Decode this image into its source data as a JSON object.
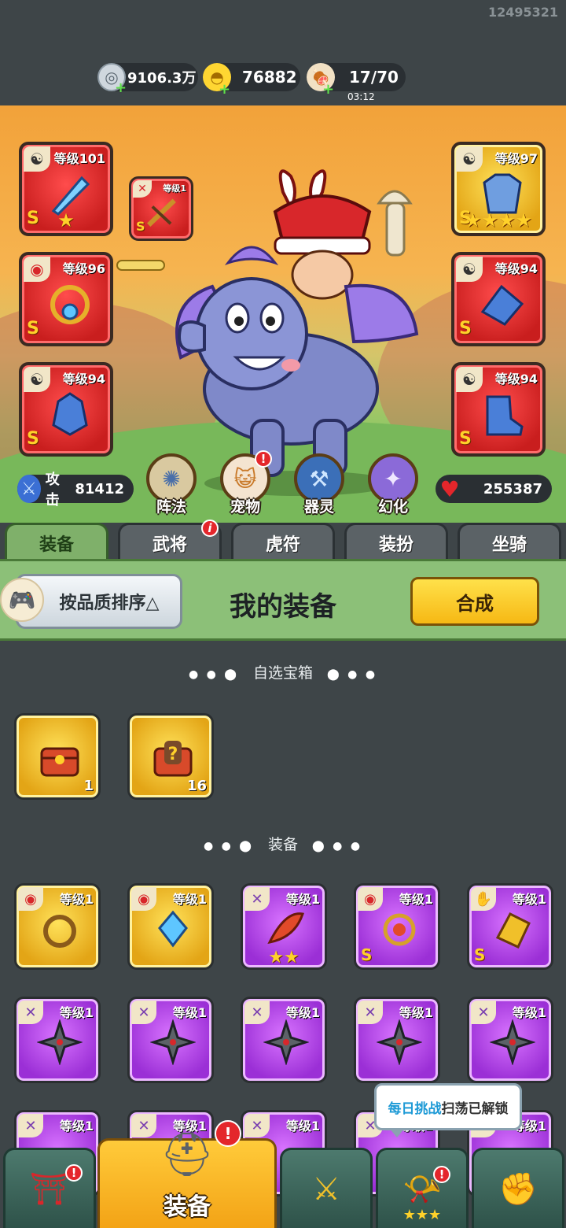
{
  "uid": "12495321",
  "resources": {
    "silver": {
      "value": "9106.3万",
      "icon": "silver-coin-icon"
    },
    "gold": {
      "value": "76882",
      "icon": "gold-ingot-icon"
    },
    "stamina": {
      "value": "17/70",
      "timer": "03:12",
      "icon": "meat-icon"
    }
  },
  "equipment_slots": {
    "left": [
      {
        "level": "等级101",
        "grade": "S",
        "stars": "★",
        "color": "red"
      },
      {
        "level": "等级96",
        "grade": "S",
        "stars": "",
        "color": "red"
      },
      {
        "level": "等级94",
        "grade": "S",
        "stars": "",
        "color": "red"
      }
    ],
    "linked": {
      "level": "等级1",
      "grade": "S"
    },
    "right": [
      {
        "level": "等级97",
        "grade": "S",
        "stars": "★★★★",
        "color": "gold"
      },
      {
        "level": "等级94",
        "grade": "S",
        "stars": "",
        "color": "red"
      },
      {
        "level": "等级94",
        "grade": "S",
        "stars": "",
        "color": "red"
      }
    ]
  },
  "stats": {
    "attack_label": "攻击",
    "attack_value": "81412",
    "hp_value": "255387"
  },
  "round_buttons": [
    {
      "label": "阵法",
      "icon": "formation-icon"
    },
    {
      "label": "宠物",
      "icon": "pet-cat-icon",
      "alert": "!"
    },
    {
      "label": "器灵",
      "icon": "spirit-icon"
    },
    {
      "label": "幻化",
      "icon": "transform-icon"
    }
  ],
  "tabs": [
    {
      "label": "装备",
      "active": true
    },
    {
      "label": "武将",
      "alert": "i"
    },
    {
      "label": "虎符"
    },
    {
      "label": "装扮"
    },
    {
      "label": "坐骑"
    }
  ],
  "subbar": {
    "sort_label": "按品质排序△",
    "title": "我的装备",
    "synth_label": "合成"
  },
  "sections": {
    "chest_title": "自选宝箱",
    "equip_title": "装备",
    "dots_left": "● ● ⬤",
    "dots_right": "⬤ ● ●"
  },
  "chests": [
    {
      "count": "1"
    },
    {
      "count": "16"
    }
  ],
  "equip_row1": [
    {
      "level": "等级1",
      "color": "gold",
      "grade": "",
      "stars": ""
    },
    {
      "level": "等级1",
      "color": "gold",
      "grade": "",
      "stars": ""
    },
    {
      "level": "等级1",
      "color": "purple",
      "grade": "",
      "stars": "★★"
    },
    {
      "level": "等级1",
      "color": "purple",
      "grade": "S",
      "stars": ""
    },
    {
      "level": "等级1",
      "color": "purple",
      "grade": "S",
      "stars": ""
    }
  ],
  "equip_row2": [
    {
      "level": "等级1"
    },
    {
      "level": "等级1"
    },
    {
      "level": "等级1"
    },
    {
      "level": "等级1"
    },
    {
      "level": "等级1"
    }
  ],
  "equip_row3": [
    {
      "level": "等级1"
    },
    {
      "level": "等级1"
    },
    {
      "level": "等级1"
    },
    {
      "level": "等级1"
    },
    {
      "level": "等级1"
    }
  ],
  "tooltip": {
    "highlight": "每日挑战",
    "rest": "扫荡已解锁"
  },
  "bottom_nav": [
    {
      "icon": "shop-icon",
      "alert": "!"
    },
    {
      "label": "装备",
      "icon": "helmet-icon",
      "active": true,
      "alert": "!"
    },
    {
      "icon": "battle-swords-icon"
    },
    {
      "icon": "horn-icon",
      "alert": "!",
      "stars": "★★★"
    },
    {
      "icon": "upgrade-fist-icon"
    }
  ],
  "colors": {
    "accent_gold": "#f6b814",
    "tab_active": "#7fb06a",
    "bg": "#3e4548"
  }
}
